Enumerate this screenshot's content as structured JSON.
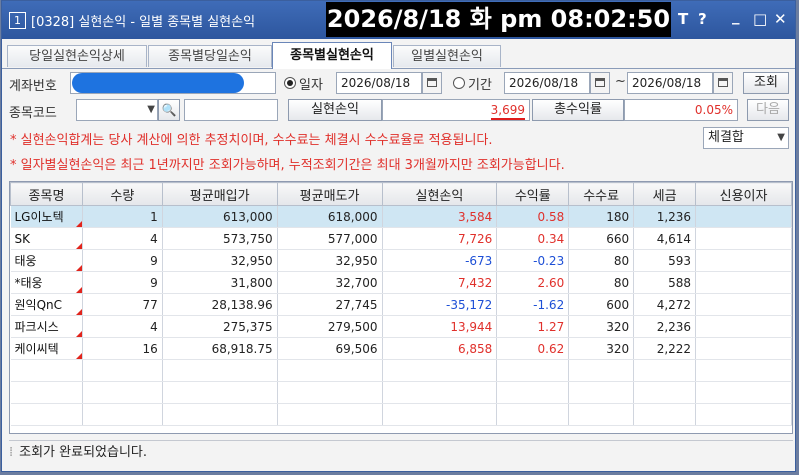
{
  "window": {
    "number": "1",
    "title": "[0328] 실현손익 - 일별 종목별 실현손익",
    "clock": "2026/8/18 화 pm 08:02:50",
    "btn_t": "T",
    "btn_help": "?",
    "btn_min": "_",
    "btn_max": "□",
    "btn_close": "✕"
  },
  "tabs": [
    "당일실현손익상세",
    "종목별당일손익",
    "종목별실현손익",
    "일별실현손익"
  ],
  "form": {
    "account_label": "계좌번호",
    "radio_date": "일자",
    "date_value": "2026/08/18",
    "radio_period": "기간",
    "period_from": "2026/08/18",
    "period_tilde": "~",
    "period_to": "2026/08/18",
    "search_button": "조회",
    "code_label": "종목코드",
    "realized_label": "실현손익",
    "realized_value": "3,699",
    "total_rate_label": "총수익률",
    "total_rate_value": "0.05%",
    "next_button": "다음",
    "combine_select": "체결합"
  },
  "notices": [
    "* 실현손익합계는 당사 계산에 의한 추정치이며, 수수료는 체결시 수수료율로 적용됩니다.",
    "* 일자별실현손익은 최근 1년까지만 조회가능하며, 누적조회기간은 최대 3개월까지만 조회가능합니다."
  ],
  "table": {
    "headers": [
      "종목명",
      "수량",
      "평균매입가",
      "평균매도가",
      "실현손익",
      "수익률",
      "수수료",
      "세금",
      "신용이자"
    ],
    "rows": [
      {
        "name": "LG이노텍",
        "qty": "1",
        "buy": "613,000",
        "sell": "618,000",
        "pnl": "3,584",
        "rate": "0.58",
        "fee": "180",
        "tax": "1,236",
        "credit": "",
        "sign": "pos"
      },
      {
        "name": "SK",
        "qty": "4",
        "buy": "573,750",
        "sell": "577,000",
        "pnl": "7,726",
        "rate": "0.34",
        "fee": "660",
        "tax": "4,614",
        "credit": "",
        "sign": "pos"
      },
      {
        "name": "태웅",
        "qty": "9",
        "buy": "32,950",
        "sell": "32,950",
        "pnl": "-673",
        "rate": "-0.23",
        "fee": "80",
        "tax": "593",
        "credit": "",
        "sign": "neg"
      },
      {
        "name": "*태웅",
        "qty": "9",
        "buy": "31,800",
        "sell": "32,700",
        "pnl": "7,432",
        "rate": "2.60",
        "fee": "80",
        "tax": "588",
        "credit": "",
        "sign": "pos"
      },
      {
        "name": "원익QnC",
        "qty": "77",
        "buy": "28,138.96",
        "sell": "27,745",
        "pnl": "-35,172",
        "rate": "-1.62",
        "fee": "600",
        "tax": "4,272",
        "credit": "",
        "sign": "neg"
      },
      {
        "name": "파크시스",
        "qty": "4",
        "buy": "275,375",
        "sell": "279,500",
        "pnl": "13,944",
        "rate": "1.27",
        "fee": "320",
        "tax": "2,236",
        "credit": "",
        "sign": "pos"
      },
      {
        "name": "케이씨텍",
        "qty": "16",
        "buy": "68,918.75",
        "sell": "69,506",
        "pnl": "6,858",
        "rate": "0.62",
        "fee": "320",
        "tax": "2,222",
        "credit": "",
        "sign": "pos"
      }
    ]
  },
  "status": "조회가 완료되었습니다.",
  "colors": {
    "accent": "#3f6cb8",
    "positive": "#e0302b",
    "negative": "#1d4fd6",
    "selected_row": "#cfe6f3"
  }
}
